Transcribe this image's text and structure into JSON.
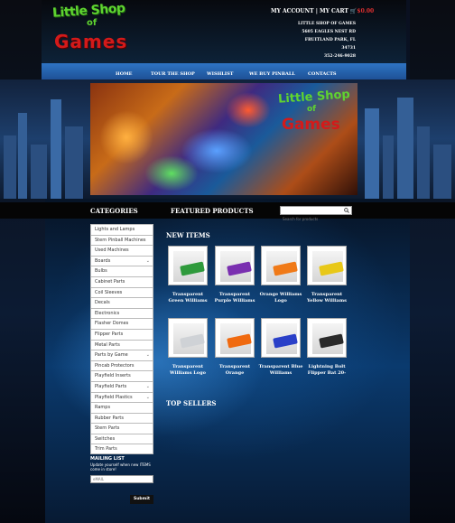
{
  "header": {
    "logo_line1": "Little Shop",
    "logo_line2": "of",
    "logo_line3": "Games",
    "my_account": "MY ACCOUNT",
    "separator": "|",
    "my_cart": "MY CART",
    "cart_total": "$0.00",
    "store_name": "LITTLE SHOP OF GAMES",
    "street": "5605 EAGLES NEST RD",
    "city": "FRUITLAND PARK, FL 34731",
    "phone": "352-246-9028"
  },
  "nav": {
    "items": [
      "HOME",
      "TOUR THE SHOP",
      "WISHLIST",
      "WE BUY PINBALL",
      "CONTACTS"
    ]
  },
  "hero": {
    "logo_line1": "Little Shop",
    "logo_line2": "of",
    "logo_line3": "Games"
  },
  "bar": {
    "categories_title": "CATEGORIES",
    "featured_title": "FEATURED PRODUCTS",
    "search_placeholder": "Search for products"
  },
  "categories": [
    {
      "label": "Lights and Lamps",
      "expandable": false
    },
    {
      "label": "Stern Pinball Machines",
      "expandable": false
    },
    {
      "label": "Used Machines",
      "expandable": false
    },
    {
      "label": "Boards",
      "expandable": true
    },
    {
      "label": "Bulbs",
      "expandable": false
    },
    {
      "label": "Cabinet Parts",
      "expandable": false
    },
    {
      "label": "Coil Sleeves",
      "expandable": false
    },
    {
      "label": "Decals",
      "expandable": false
    },
    {
      "label": "Electronics",
      "expandable": false
    },
    {
      "label": "Flasher Domes",
      "expandable": false
    },
    {
      "label": "Flipper Parts",
      "expandable": false
    },
    {
      "label": "Metal Parts",
      "expandable": false
    },
    {
      "label": "Parts by Game",
      "expandable": true
    },
    {
      "label": "Pincab Protectors",
      "expandable": false
    },
    {
      "label": "Playfield Inserts",
      "expandable": false
    },
    {
      "label": "Playfield Parts",
      "expandable": true
    },
    {
      "label": "Playfield Plastics",
      "expandable": true
    },
    {
      "label": "Ramps",
      "expandable": false
    },
    {
      "label": "Rubber Parts",
      "expandable": false
    },
    {
      "label": "Stern Parts",
      "expandable": false
    },
    {
      "label": "Switches",
      "expandable": false
    },
    {
      "label": "Trim Parts",
      "expandable": false
    }
  ],
  "mailing": {
    "title": "MAILING LIST",
    "subtitle": "Update yourself when new ITEMS come in store!",
    "email_placeholder": "eMAIL",
    "submit_label": "Submit"
  },
  "new_items": {
    "title": "NEW ITEMS",
    "products": [
      {
        "name": "Transparent Green Williams",
        "color": "#2f9a3c"
      },
      {
        "name": "Transparent Purple Williams",
        "color": "#7a2fb0"
      },
      {
        "name": "Orange Williams Logo",
        "color": "#f07a18"
      },
      {
        "name": "Transparent Yellow Williams",
        "color": "#e8c818"
      },
      {
        "name": "Transparent Williams Logo",
        "color": "#cfd2d6"
      },
      {
        "name": "Transparent Orange",
        "color": "#f06a10"
      },
      {
        "name": "Transparent Blue Williams",
        "color": "#2a40c8"
      },
      {
        "name": "Lightning Bolt Flipper Bat 20-",
        "color": "#2a2a2a"
      }
    ]
  },
  "top_sellers": {
    "title": "TOP SELLERS"
  }
}
